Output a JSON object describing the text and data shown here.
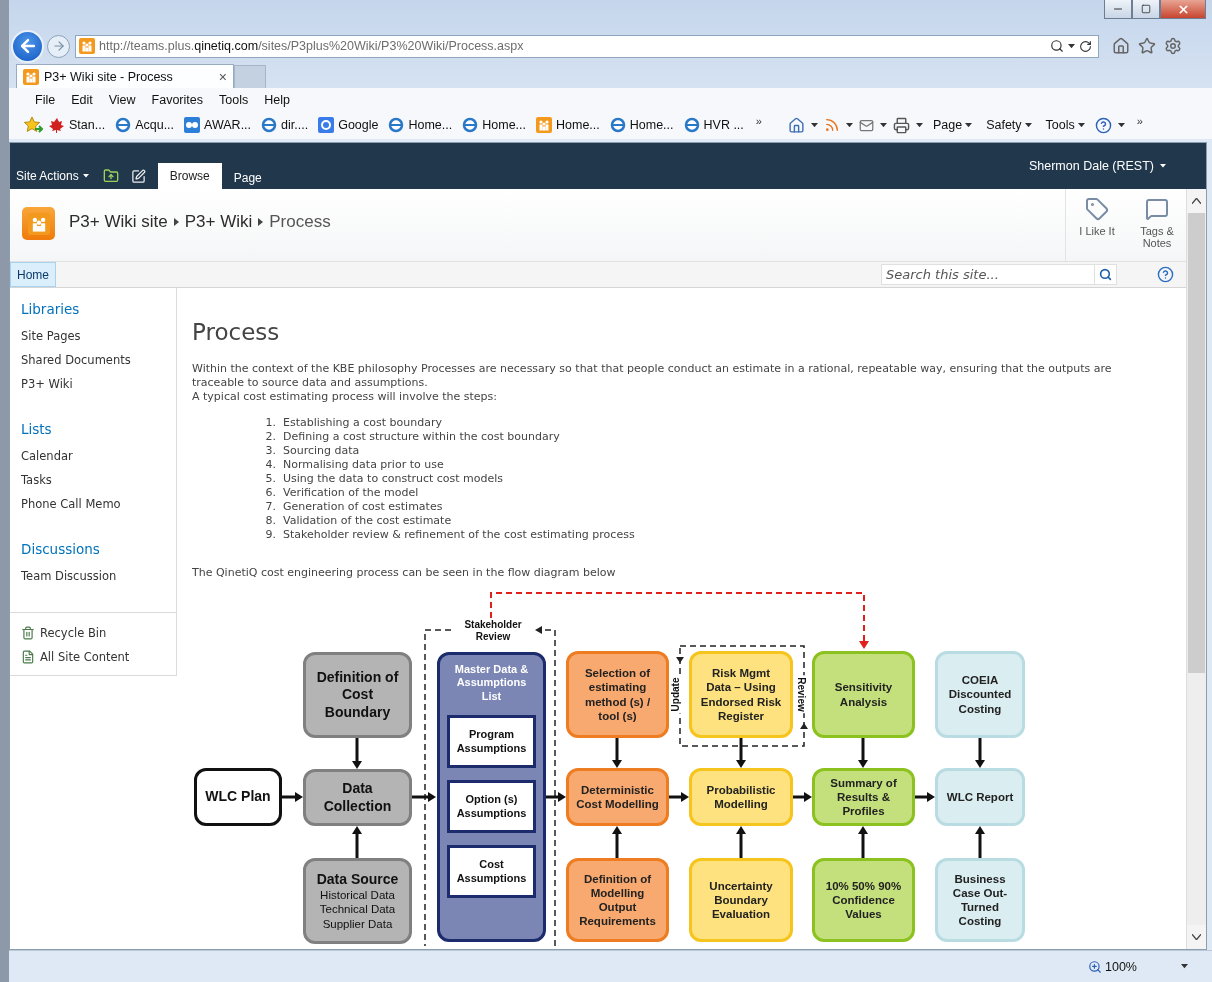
{
  "browser": {
    "address": {
      "prefix": "http://teams.plus.",
      "domain": "qinetiq.com",
      "path": "/sites/P3plus%20Wiki/P3%20Wiki/Process.aspx"
    },
    "tabs": [
      {
        "label": "P3+ Wiki site - Process",
        "selected": true,
        "close": "×"
      }
    ],
    "menu": [
      "File",
      "Edit",
      "View",
      "Favorites",
      "Tools",
      "Help"
    ],
    "favorites": [
      {
        "kind": "add"
      },
      {
        "label": "Stan...",
        "kind": "leaf"
      },
      {
        "label": "Acqu...",
        "kind": "browser"
      },
      {
        "label": "AWAR...",
        "kind": "app"
      },
      {
        "label": "dir....",
        "kind": "browser"
      },
      {
        "label": "Google",
        "kind": "search"
      },
      {
        "label": "Home...",
        "kind": "browser"
      },
      {
        "label": "Home...",
        "kind": "browser"
      },
      {
        "label": "Home...",
        "kind": "site"
      },
      {
        "label": "Home...",
        "kind": "browser"
      },
      {
        "label": "HVR ...",
        "kind": "browser"
      }
    ],
    "favorites_more": "»",
    "commands": [
      {
        "kind": "home"
      },
      {
        "kind": "feed"
      },
      {
        "kind": "mail"
      },
      {
        "kind": "print"
      },
      {
        "kind": "menu",
        "label": "Page"
      },
      {
        "kind": "menu",
        "label": "Safety"
      },
      {
        "kind": "menu",
        "label": "Tools"
      },
      {
        "kind": "help"
      }
    ],
    "commands_more": "»",
    "zoom": "100%"
  },
  "ribbon": {
    "site_actions": "Site Actions",
    "tabs": [
      {
        "label": "Browse",
        "selected": true
      },
      {
        "label": "Page",
        "selected": false
      }
    ],
    "user": "Shermon Dale (REST)"
  },
  "title_area": {
    "breadcrumb": [
      "P3+ Wiki site",
      "P3+ Wiki",
      "Process"
    ],
    "actions": [
      {
        "label": "I Like It",
        "kind": "like"
      },
      {
        "label": "Tags & Notes",
        "kind": "tags"
      }
    ]
  },
  "top_nav": {
    "items": [
      {
        "label": "Home",
        "selected": true
      }
    ],
    "search": {
      "placeholder": "Search this site..."
    }
  },
  "quick_launch": [
    {
      "heading": "Libraries",
      "items": [
        "Site Pages",
        "Shared Documents",
        "P3+ Wiki"
      ]
    },
    {
      "heading": "Lists",
      "items": [
        "Calendar",
        "Tasks",
        "Phone Call Memo"
      ]
    },
    {
      "heading": "Discussions",
      "items": [
        "Team Discussion"
      ]
    }
  ],
  "footer_links": [
    {
      "label": "Recycle Bin",
      "kind": "recycle"
    },
    {
      "label": "All Site Content",
      "kind": "content"
    }
  ],
  "page": {
    "title": "Process",
    "intro": "Within the context of the KBE philosophy Processes are necessary so that that people conduct an estimate in a rational, repeatable way, ensuring that the outputs are traceable to source data and assumptions.",
    "lead": "A typical cost estimating process will involve the steps:",
    "steps": [
      {
        "number": "1.",
        "text": "Establishing a cost boundary"
      },
      {
        "number": "2.",
        "text": "Defining a cost structure within the cost boundary"
      },
      {
        "number": "3.",
        "text": "Sourcing data"
      },
      {
        "number": "4.",
        "text": "Normalising data prior to use"
      },
      {
        "number": "5.",
        "text": "Using the data to construct cost models"
      },
      {
        "number": "6.",
        "text": "Verification of the model"
      },
      {
        "number": "7.",
        "text": "Generation of cost estimates"
      },
      {
        "number": "8.",
        "text": "Validation of the cost estimate"
      },
      {
        "number": "9.",
        "text": "Stakeholder review & refinement of the cost estimating process"
      }
    ],
    "outro": "The QinetiQ cost engineering process can be seen in the flow diagram below"
  },
  "diagram": {
    "stakeholder_label": "Stakeholder\nReview",
    "update_label": "Update",
    "review_label": "Review",
    "nodes": [
      {
        "kind": "input",
        "text": "Definition of\nCost\nBoundary"
      },
      {
        "kind": "plan",
        "text": "WLC Plan"
      },
      {
        "kind": "input",
        "text": "Data\nCollection"
      },
      {
        "kind": "input",
        "text": "Data Source",
        "detail": "Historical Data\nTechnical Data\nSupplier Data"
      },
      {
        "kind": "master",
        "text": "Master Data &\nAssumptions\nList",
        "children": [
          "Program\nAssumptions",
          "Option (s)\nAssumptions",
          "Cost\nAssumptions"
        ]
      },
      {
        "kind": "method",
        "text": "Selection of\nestimating\nmethod (s) /\ntool (s)"
      },
      {
        "kind": "method",
        "text": "Deterministic\nCost Modelling"
      },
      {
        "kind": "method",
        "text": "Definition of\nModelling\nOutput\nRequirements"
      },
      {
        "kind": "risk",
        "text": "Risk Mgmt\nData – Using\nEndorsed Risk\nRegister"
      },
      {
        "kind": "risk",
        "text": "Probabilistic\nModelling"
      },
      {
        "kind": "risk",
        "text": "Uncertainty\nBoundary\nEvaluation"
      },
      {
        "kind": "analysis",
        "text": "Sensitivity\nAnalysis"
      },
      {
        "kind": "analysis",
        "text": "Summary of\nResults &\nProfiles"
      },
      {
        "kind": "analysis",
        "text": "10% 50% 90%\nConfidence\nValues"
      },
      {
        "kind": "report",
        "text": "COEIA\nDiscounted\nCosting"
      },
      {
        "kind": "report",
        "text": "WLC Report"
      },
      {
        "kind": "report",
        "text": "Business\nCase Out-\nTurned\nCosting"
      }
    ]
  }
}
